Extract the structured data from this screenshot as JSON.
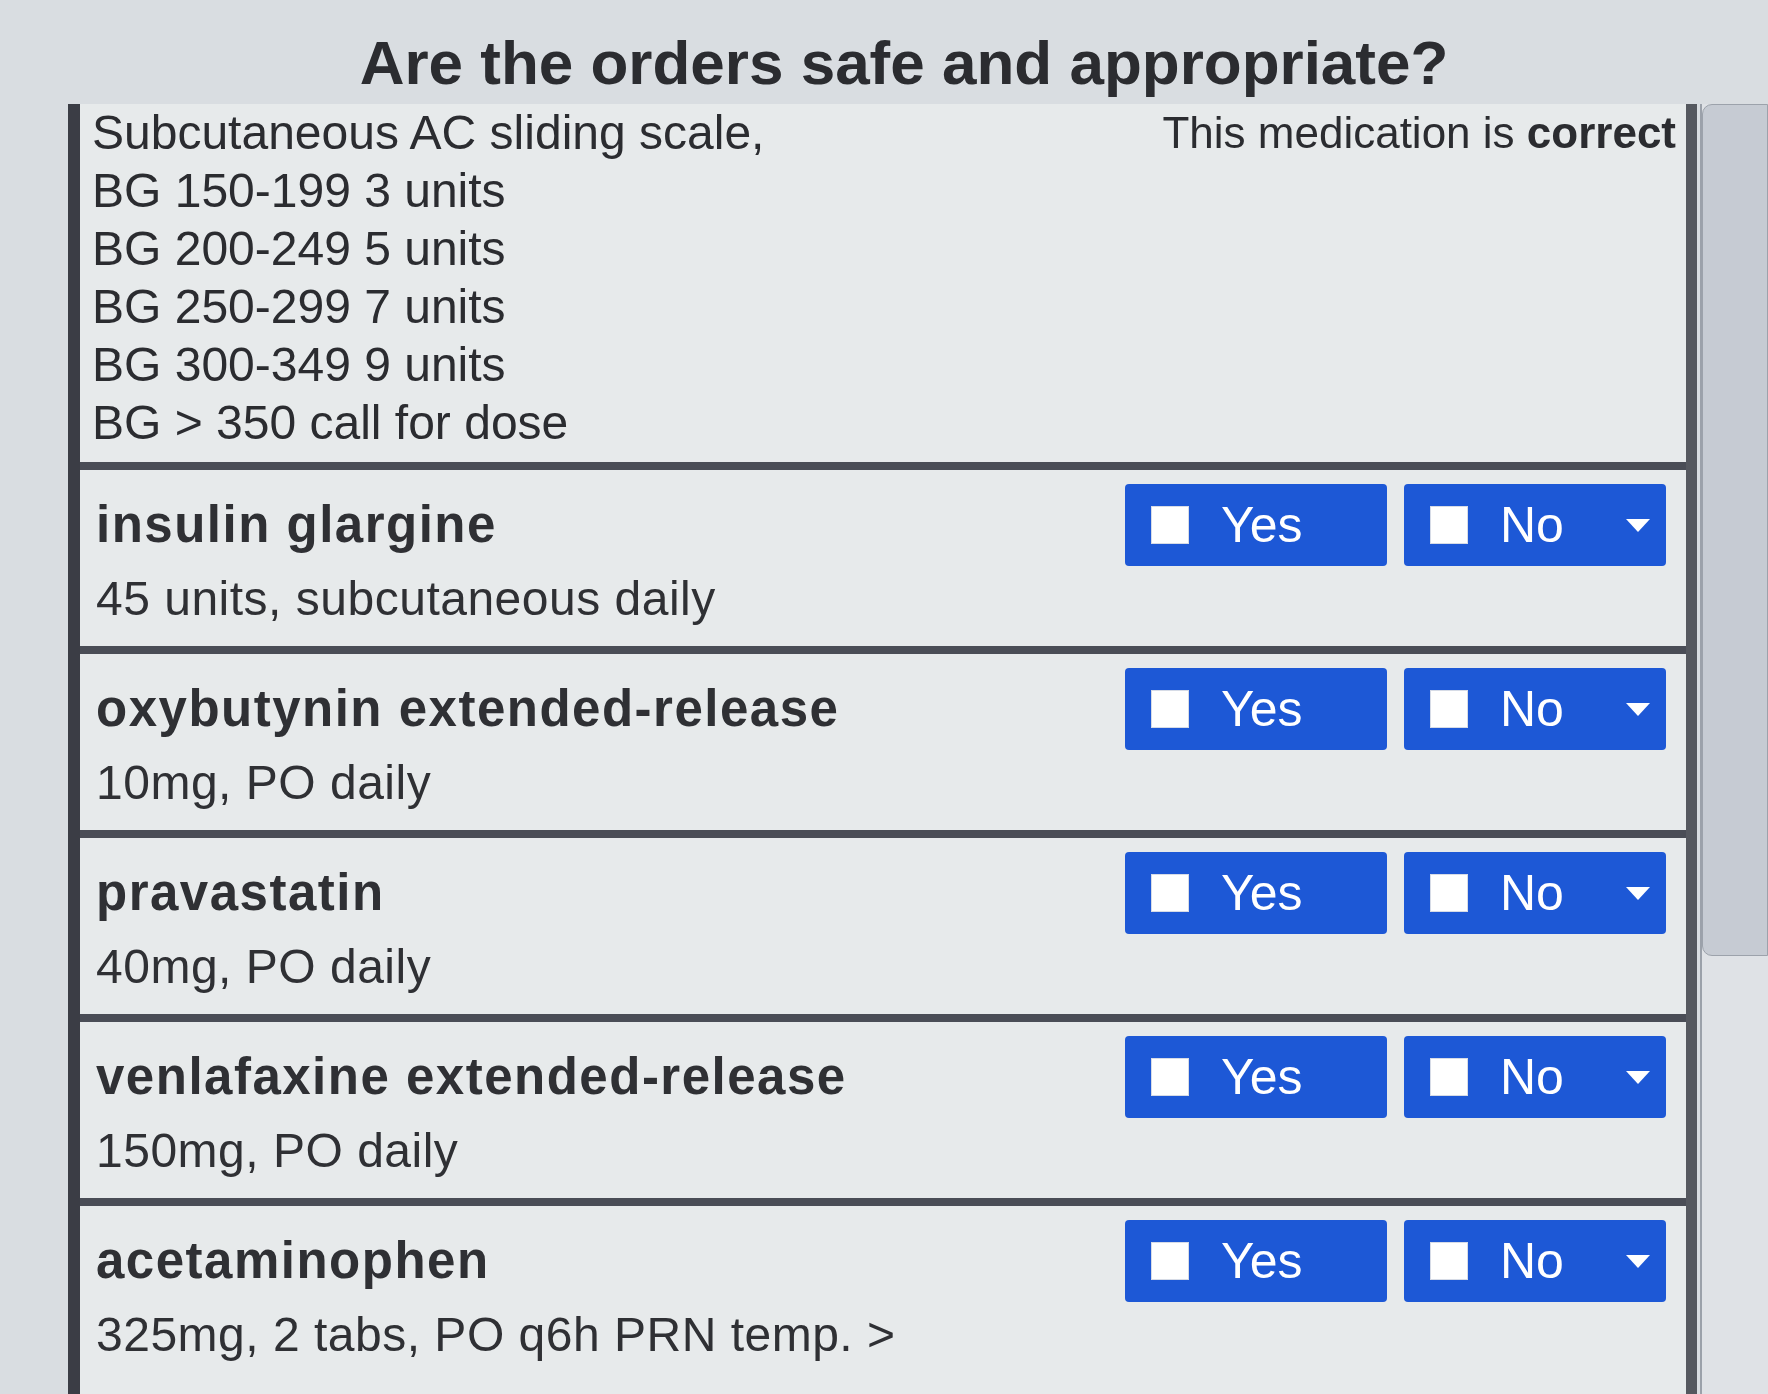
{
  "title": "Are the orders safe and appropriate?",
  "column_header": "This medication is **correct**",
  "orders": [
    {
      "kind": "continuation",
      "lines": [
        "Subcutaneous AC sliding scale,",
        "BG 150-199 3 units",
        "BG 200-249 5 units",
        "BG 250-299 7 units",
        "BG 300-349 9 units",
        "BG > 350 call for dose"
      ]
    },
    {
      "kind": "medication",
      "name": "insulin glargine",
      "dose": "45 units, subcutaneous daily",
      "yes": {
        "label": "Yes",
        "checked": false
      },
      "no": {
        "label": "No",
        "checked": false
      }
    },
    {
      "kind": "medication",
      "name": "oxybutynin extended-release",
      "dose": "10mg, PO daily",
      "yes": {
        "label": "Yes",
        "checked": false
      },
      "no": {
        "label": "No",
        "checked": false
      }
    },
    {
      "kind": "medication",
      "name": "pravastatin",
      "dose": "40mg, PO daily",
      "yes": {
        "label": "Yes",
        "checked": false
      },
      "no": {
        "label": "No",
        "checked": false
      }
    },
    {
      "kind": "medication",
      "name": "venlafaxine extended-release",
      "dose": "150mg, PO daily",
      "yes": {
        "label": "Yes",
        "checked": false
      },
      "no": {
        "label": "No",
        "checked": false
      }
    },
    {
      "kind": "medication",
      "name": "acetaminophen",
      "dose": "325mg, 2 tabs, PO q6h PRN temp. >",
      "yes": {
        "label": "Yes",
        "checked": false
      },
      "no": {
        "label": "No",
        "checked": false
      }
    }
  ]
}
